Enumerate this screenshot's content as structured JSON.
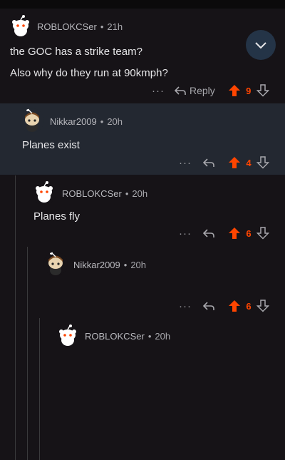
{
  "comments": [
    {
      "username": "ROBLOKCSer",
      "time": "21h",
      "body": [
        "the GOC has a strike team?",
        "Also why do they run at 90kmph?"
      ],
      "more": "···",
      "reply_label": "Reply",
      "votes": "9",
      "avatar": "snoo-default"
    },
    {
      "username": "Nikkar2009",
      "time": "20h",
      "body": [
        "Planes exist"
      ],
      "more": "···",
      "votes": "4",
      "avatar": "snoo-custom"
    },
    {
      "username": "ROBLOKCSer",
      "time": "20h",
      "body": [
        "Planes fly"
      ],
      "more": "···",
      "votes": "6",
      "avatar": "snoo-default"
    },
    {
      "username": "Nikkar2009",
      "time": "20h",
      "body": [],
      "more": "···",
      "votes": "6",
      "avatar": "snoo-custom"
    },
    {
      "username": "ROBLOKCSer",
      "time": "20h",
      "body": [],
      "avatar": "snoo-default"
    }
  ],
  "separator": "•",
  "colors": {
    "background": "#161317",
    "highlight": "#232831",
    "upvote": "#ff4500",
    "collapse_button": "#243447"
  },
  "icons": {
    "collapse": "chevron-down-icon",
    "reply": "reply-arrow-icon",
    "upvote": "upvote-arrow-icon",
    "downvote": "downvote-arrow-icon"
  }
}
